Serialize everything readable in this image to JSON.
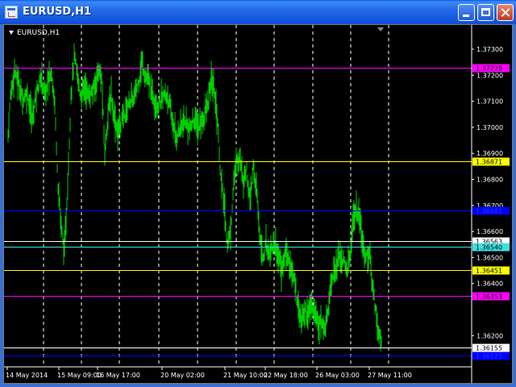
{
  "window": {
    "title": "EURUSD,H1"
  },
  "chart": {
    "symbol_label": "EURUSD,H1",
    "price_labels": [
      "1.37300",
      "1.37200",
      "1.37100",
      "1.37000",
      "1.36900",
      "1.36800",
      "1.36700",
      "1.36600",
      "1.36500",
      "1.36400",
      "1.36200"
    ],
    "time_labels": [
      "14 May 2014",
      "15 May 09:00",
      "16 May 17:00",
      "20 May 02:00",
      "21 May 10:00",
      "22 May 18:00",
      "26 May 03:00",
      "27 May 11:00"
    ],
    "levels": [
      {
        "price": 1.37229,
        "label": "1.37229",
        "color": "#ff00ff",
        "text": "#000000"
      },
      {
        "price": 1.36871,
        "label": "1.36871",
        "color": "#ffff00",
        "text": "#000000"
      },
      {
        "price": 1.36681,
        "label": "1.36681",
        "color": "#0000ff",
        "text": "#1a3cff"
      },
      {
        "price": 1.36563,
        "label": "1.36563",
        "color": "#ffffff",
        "text": "#000000"
      },
      {
        "price": 1.3654,
        "label": "1.36540",
        "color": "#40e0e0",
        "text": "#000000"
      },
      {
        "price": 1.36451,
        "label": "1.36451",
        "color": "#ffff00",
        "text": "#000000"
      },
      {
        "price": 1.36353,
        "label": "1.36353",
        "color": "#ff00ff",
        "text": "#000000"
      },
      {
        "price": 1.36155,
        "label": "1.36155",
        "color": "#ffffff",
        "text": "#000000"
      },
      {
        "price": 1.36125,
        "label": "1.36125",
        "color": "#0000ff",
        "text": "#1a3cff"
      }
    ],
    "colors": {
      "background": "#000000",
      "bars": "#00d000",
      "grid": "#ffffff",
      "axis_text": "#ffffff"
    }
  },
  "chart_data": {
    "type": "ohlc",
    "ylim": [
      1.361,
      1.374
    ],
    "grid": true,
    "x": [
      0,
      1,
      2,
      3,
      4,
      5,
      6,
      7,
      8,
      9,
      10,
      11,
      12,
      13,
      14,
      15,
      16,
      17,
      18,
      19,
      20,
      21,
      22,
      23,
      24,
      25,
      26,
      27,
      28,
      29,
      30,
      31,
      32,
      33,
      34,
      35,
      36,
      37,
      38,
      39,
      40,
      41,
      42,
      43,
      44,
      45,
      46,
      47,
      48,
      49,
      50,
      51,
      52,
      53,
      54,
      55,
      56,
      57,
      58,
      59,
      60,
      61,
      62,
      63,
      64,
      65,
      66,
      67,
      68,
      69,
      70,
      71,
      72,
      73,
      74,
      75,
      76,
      77,
      78,
      79,
      80,
      81,
      82,
      83,
      84,
      85,
      86,
      87,
      88,
      89,
      90,
      91,
      92,
      93,
      94,
      95,
      96,
      97,
      98,
      99,
      100,
      101,
      102,
      103,
      104,
      105,
      106,
      107,
      108,
      109,
      110,
      111,
      112,
      113,
      114,
      115,
      116,
      117,
      118,
      119,
      120,
      121,
      122,
      123,
      124,
      125,
      126,
      127,
      128,
      129,
      130,
      131,
      132,
      133,
      134,
      135,
      136,
      137,
      138,
      139,
      140,
      141,
      142,
      143,
      144,
      145,
      146,
      147,
      148,
      149,
      150,
      151,
      152,
      153,
      154,
      155,
      156,
      157,
      158,
      159,
      160,
      161,
      162,
      163,
      164,
      165,
      166,
      167,
      168,
      169,
      170,
      171,
      172,
      173,
      174,
      175,
      176,
      177,
      178,
      179,
      180,
      181,
      182,
      183,
      184,
      185,
      186,
      187,
      188,
      189,
      190,
      191,
      192,
      193,
      194,
      195,
      196,
      197,
      198,
      199,
      200,
      201,
      202,
      203,
      204,
      205,
      206,
      207,
      208,
      209,
      210,
      211,
      212,
      213,
      214,
      215,
      216,
      217,
      218,
      219,
      220,
      221,
      222,
      223,
      224,
      225,
      226,
      227,
      228,
      229,
      230,
      231,
      232,
      233,
      234,
      235,
      236,
      237,
      238,
      239,
      240,
      241,
      242,
      243,
      244,
      245,
      246,
      247,
      248,
      249,
      250,
      251,
      252,
      253,
      254,
      255,
      256,
      257,
      258,
      259,
      260,
      261,
      262,
      263,
      264,
      265,
      266,
      267,
      268,
      269,
      270,
      271,
      272,
      273,
      274,
      275,
      276,
      277,
      278,
      279,
      280,
      281,
      282,
      283,
      284,
      285,
      286,
      287,
      288,
      289,
      290,
      291,
      292,
      293,
      294,
      295,
      296,
      297,
      298,
      299,
      300,
      301,
      302,
      303,
      304,
      305,
      306,
      307,
      308,
      309,
      310,
      311,
      312,
      313,
      314,
      315,
      316,
      317,
      318,
      319,
      320,
      321,
      322,
      323,
      324,
      325,
      326,
      327,
      328,
      329,
      330,
      331,
      332,
      333,
      334,
      335,
      336,
      337,
      338,
      339,
      340,
      341,
      342,
      343,
      344,
      345,
      346,
      347,
      348,
      349,
      350,
      351,
      352,
      353,
      354,
      355,
      356,
      357,
      358,
      359,
      360,
      361,
      362,
      363,
      364,
      365,
      366,
      367,
      368,
      369,
      370,
      371,
      372,
      373,
      374,
      375,
      376,
      377,
      378,
      379,
      380,
      381,
      382,
      383,
      384,
      385,
      386,
      387,
      388,
      389,
      390,
      391,
      392,
      393,
      394,
      395,
      396,
      397,
      398,
      399,
      400,
      401,
      402,
      403,
      404,
      405,
      406,
      407,
      408,
      409,
      410,
      411,
      412,
      413,
      414,
      415,
      416,
      417,
      418,
      419,
      420,
      421,
      422,
      423,
      424,
      425,
      426,
      427,
      428,
      429,
      430,
      431,
      432,
      433,
      434,
      435,
      436,
      437,
      438,
      439,
      440,
      441,
      442,
      443,
      444,
      445,
      446,
      447,
      448,
      449,
      450,
      451,
      452,
      453,
      454,
      455,
      456,
      457,
      458,
      459,
      460,
      461,
      462,
      463,
      464,
      465,
      466,
      467,
      468,
      469,
      470,
      471,
      472,
      473,
      474,
      475,
      476,
      477,
      478,
      479,
      480,
      481,
      482,
      483,
      484,
      485,
      486,
      487,
      488,
      489,
      490,
      491,
      492,
      493,
      494,
      495,
      496,
      497,
      498,
      499,
      500,
      501,
      502,
      503,
      504,
      505,
      506,
      507,
      508,
      509,
      510,
      511,
      512,
      513,
      514,
      515,
      516,
      517,
      518,
      519,
      520,
      521,
      522,
      523,
      524,
      525,
      526,
      527,
      528,
      529,
      530,
      531,
      532,
      533,
      534,
      535,
      536,
      537,
      538,
      539,
      540,
      541,
      542,
      543,
      544,
      545,
      546,
      547,
      548,
      549,
      550,
      551,
      552,
      553,
      554,
      555,
      556,
      557,
      558,
      559,
      560,
      561,
      562,
      563,
      564,
      565,
      566,
      567,
      568,
      569,
      570,
      571,
      572,
      573,
      574,
      575,
      576,
      577,
      578,
      579
    ],
    "price_path": [
      [
        0,
        1.3697
      ],
      [
        3,
        1.3712
      ],
      [
        8,
        1.3722
      ],
      [
        12,
        1.3718
      ],
      [
        18,
        1.3711
      ],
      [
        24,
        1.3713
      ],
      [
        30,
        1.3703
      ],
      [
        36,
        1.3715
      ],
      [
        42,
        1.3719
      ],
      [
        46,
        1.3712
      ],
      [
        50,
        1.3718
      ],
      [
        54,
        1.3721
      ],
      [
        58,
        1.3709
      ],
      [
        62,
        1.3678
      ],
      [
        66,
        1.3662
      ],
      [
        70,
        1.3652
      ],
      [
        74,
        1.3678
      ],
      [
        78,
        1.3712
      ],
      [
        82,
        1.3727
      ],
      [
        86,
        1.372
      ],
      [
        90,
        1.3712
      ],
      [
        95,
        1.3716
      ],
      [
        100,
        1.3712
      ],
      [
        106,
        1.3714
      ],
      [
        112,
        1.3722
      ],
      [
        116,
        1.3718
      ],
      [
        120,
        1.369
      ],
      [
        124,
        1.3706
      ],
      [
        128,
        1.3712
      ],
      [
        132,
        1.3704
      ],
      [
        136,
        1.3698
      ],
      [
        140,
        1.3702
      ],
      [
        146,
        1.3706
      ],
      [
        150,
        1.371
      ],
      [
        156,
        1.3711
      ],
      [
        162,
        1.3718
      ],
      [
        166,
        1.3725
      ],
      [
        170,
        1.372
      ],
      [
        174,
        1.3718
      ],
      [
        180,
        1.3712
      ],
      [
        186,
        1.3708
      ],
      [
        192,
        1.3712
      ],
      [
        198,
        1.3712
      ],
      [
        204,
        1.3702
      ],
      [
        208,
        1.3696
      ],
      [
        214,
        1.37
      ],
      [
        220,
        1.3702
      ],
      [
        226,
        1.3699
      ],
      [
        230,
        1.3703
      ],
      [
        236,
        1.37
      ],
      [
        242,
        1.3703
      ],
      [
        248,
        1.3709
      ],
      [
        252,
        1.3718
      ],
      [
        256,
        1.3714
      ],
      [
        260,
        1.3702
      ],
      [
        264,
        1.368
      ],
      [
        268,
        1.367
      ],
      [
        272,
        1.3655
      ],
      [
        276,
        1.366
      ],
      [
        280,
        1.368
      ],
      [
        284,
        1.3687
      ],
      [
        288,
        1.3688
      ],
      [
        292,
        1.368
      ],
      [
        296,
        1.3684
      ],
      [
        300,
        1.367
      ],
      [
        304,
        1.3685
      ],
      [
        308,
        1.3676
      ],
      [
        312,
        1.366
      ],
      [
        316,
        1.365
      ],
      [
        320,
        1.3655
      ],
      [
        324,
        1.3652
      ],
      [
        330,
        1.3656
      ],
      [
        336,
        1.365
      ],
      [
        340,
        1.3645
      ],
      [
        344,
        1.3652
      ],
      [
        348,
        1.365
      ],
      [
        352,
        1.3644
      ],
      [
        356,
        1.364
      ],
      [
        360,
        1.3632
      ],
      [
        364,
        1.3625
      ],
      [
        368,
        1.363
      ],
      [
        372,
        1.3628
      ],
      [
        376,
        1.3632
      ],
      [
        380,
        1.363
      ],
      [
        384,
        1.3626
      ],
      [
        388,
        1.3625
      ],
      [
        392,
        1.3622
      ],
      [
        396,
        1.3628
      ],
      [
        400,
        1.364
      ],
      [
        404,
        1.3645
      ],
      [
        408,
        1.3648
      ],
      [
        412,
        1.3651
      ],
      [
        416,
        1.3648
      ],
      [
        420,
        1.3645
      ],
      [
        424,
        1.365
      ],
      [
        428,
        1.3665
      ],
      [
        432,
        1.3668
      ],
      [
        436,
        1.3664
      ],
      [
        440,
        1.3655
      ],
      [
        444,
        1.365
      ],
      [
        448,
        1.3652
      ],
      [
        452,
        1.364
      ],
      [
        456,
        1.363
      ],
      [
        460,
        1.362
      ],
      [
        463,
        1.3617
      ]
    ]
  }
}
